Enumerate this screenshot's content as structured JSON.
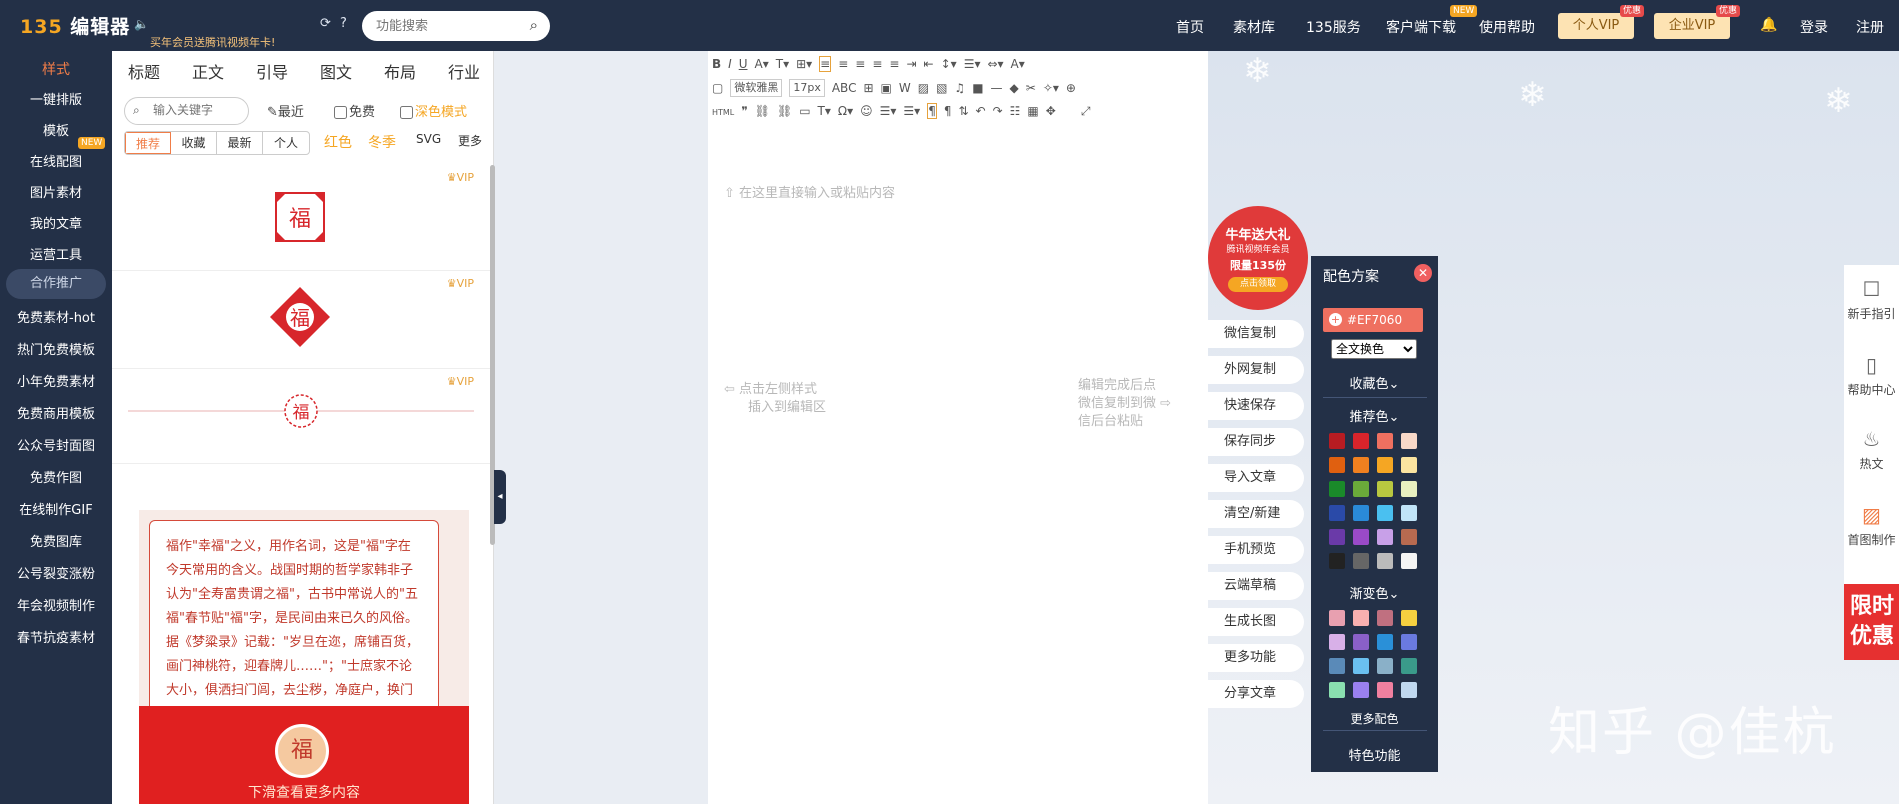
{
  "topbar": {
    "logo_num": "135",
    "logo_text": "编辑器",
    "promo": "买年会员送腾讯视频年卡!",
    "search_placeholder": "功能搜索",
    "nav": [
      "首页",
      "素材库",
      "135服务",
      "客户端下载",
      "使用帮助"
    ],
    "nav_badge": "NEW",
    "vip_personal": "个人VIP",
    "vip_enterprise": "企业VIP",
    "vip_badge": "优惠",
    "login": "登录",
    "register": "注册"
  },
  "sidebar": {
    "items": [
      "样式",
      "一键排版",
      "模板",
      "在线配图",
      "图片素材",
      "我的文章",
      "运营工具",
      "合作推广",
      "免费素材-hot",
      "热门免费模板",
      "小年免费素材",
      "免费商用模板",
      "公众号封面图",
      "免费作图",
      "在线制作GIF",
      "免费图库",
      "公号裂变涨粉",
      "年会视频制作",
      "春节抗疫素材"
    ],
    "new_badge": "NEW"
  },
  "panel": {
    "tabs": [
      "标题",
      "正文",
      "引导",
      "图文",
      "布局",
      "行业"
    ],
    "keyword_placeholder": "输入关键字",
    "recent": "最近",
    "free": "免费",
    "dark": "深色模式",
    "segments": [
      "推荐",
      "收藏",
      "最新",
      "个人"
    ],
    "categories": [
      {
        "label": "红色",
        "color": "#f5a623"
      },
      {
        "label": "冬季",
        "color": "#f5a623"
      },
      {
        "label": "SVG",
        "color": "#333333"
      },
      {
        "label": "更多",
        "color": "#333333"
      }
    ],
    "vip": "VIP",
    "card_text": "福作\"幸福\"之义，用作名词，这是\"福\"字在今天常用的含义。战国时期的哲学家韩非子认为\"全寿富贵谓之福\"，古书中常说人的\"五福\"春节贴\"福\"字，是民间由来已久的风俗。据《梦粱录》记载：\"岁旦在迩，席铺百货，画门神桃符，迎春牌儿……\"；\"士庶家不论大小，俱洒扫门闾，去尘秽，净庭户，换门神，挂钟馗，钉桃符，贴春牌……\"",
    "seal_char": "福",
    "scroll_more": "下滑查看更多内容"
  },
  "editor": {
    "font": "微软雅黑",
    "size": "17px",
    "abc": "ABC",
    "html_label": "HTML",
    "placeholder": "在这里直接输入或粘贴内容",
    "left_hint_1": "点击左侧样式",
    "left_hint_2": "插入到编辑区",
    "right_hint_1": "编辑完成后点",
    "right_hint_2": "微信复制到微",
    "right_hint_3": "信后台粘贴"
  },
  "promo_badge": [
    "牛年送大礼",
    "腾讯视频年会员",
    "限量135份",
    "点击领取"
  ],
  "side_buttons": [
    "微信复制",
    "外网复制",
    "快速保存",
    "保存同步",
    "导入文章",
    "清空/新建",
    "手机预览",
    "云端草稿",
    "生成长图",
    "更多功能",
    "分享文章"
  ],
  "color_panel": {
    "title": "配色方案",
    "close": "✕",
    "hex": "#EF7060",
    "select_value": "全文换色",
    "favorites": "收藏色",
    "recommended": "推荐色",
    "gradient": "渐变色",
    "more_colors": "更多配色",
    "special": "特色功能",
    "recommended_colors": [
      "#b81c22",
      "#d8242b",
      "#ef7060",
      "#f8d8c8",
      "#e06010",
      "#f08020",
      "#f5a623",
      "#fbe4a0",
      "#1a8a2a",
      "#6aaa3a",
      "#b8c840",
      "#e8f0c0",
      "#2a4aa8",
      "#2a8ad8",
      "#4ac0f0",
      "#c0e4f8",
      "#6a3aa8",
      "#9a4ac8",
      "#c8a0e8",
      "#b86a50",
      "#222222",
      "#666666",
      "#bbbbbb",
      "#f4f4f4"
    ],
    "gradient_colors": [
      "#e8a0b0",
      "#f8b0b0",
      "#c07080",
      "#f5d040",
      "#d8b0e8",
      "#8a60c8",
      "#2a90d8",
      "#6a7ae0",
      "#5a8ab8",
      "#6ac0f0",
      "#8ab0c8",
      "#3a9a8a",
      "#8ae0b0",
      "#9a80f0",
      "#f080a0",
      "#c0d8f0"
    ]
  },
  "right_tools": [
    "新手指引",
    "帮助中心",
    "热文",
    "首图制作"
  ],
  "limit_offer": "限时优惠",
  "watermark": "知乎 @佳杭"
}
